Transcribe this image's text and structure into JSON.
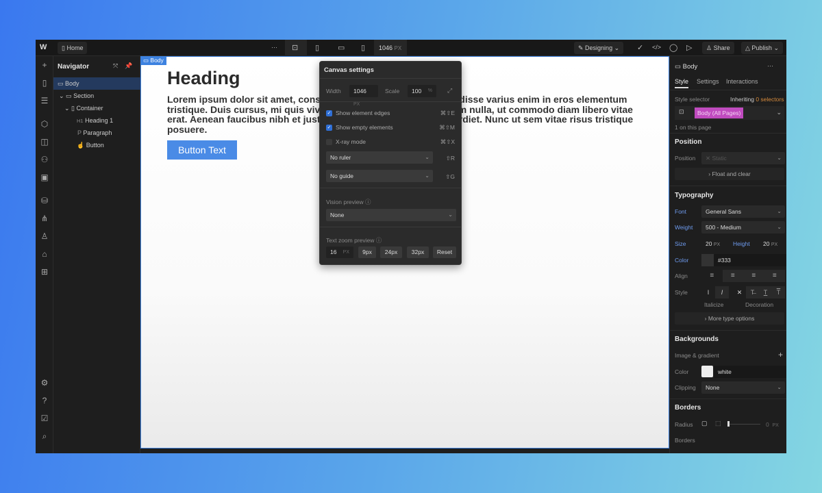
{
  "topbar": {
    "logo": "W",
    "page": "Home",
    "more": "···",
    "width_value": "1046",
    "width_unit": "PX",
    "mode": "Designing",
    "share": "Share",
    "publish": "Publish"
  },
  "navigator": {
    "title": "Navigator",
    "items": [
      {
        "label": "Body",
        "icon": "box-icon"
      },
      {
        "label": "Section",
        "icon": "box-icon"
      },
      {
        "label": "Container",
        "icon": "container-icon"
      },
      {
        "label": "Heading 1",
        "tag": "H1"
      },
      {
        "label": "Paragraph",
        "tag": "P"
      },
      {
        "label": "Button",
        "icon": "hand-icon"
      }
    ]
  },
  "canvas": {
    "body_badge": "Body",
    "heading": "Heading",
    "paragraph": "Lorem ipsum dolor sit amet, consectetur adipiscing elit. Suspendisse varius enim in eros elementum tristique. Duis cursus, mi quis viverra ornare, eros dolor interdum nulla, ut commodo diam libero vitae erat. Aenean faucibus nibh et justo cursus id rutrum lorem imperdiet. Nunc ut sem vitae risus tristique posuere.",
    "button": "Button Text",
    "button_color": "#4a8be6"
  },
  "canvas_settings": {
    "title": "Canvas settings",
    "width_label": "Width",
    "width_value": "1046",
    "width_unit": "PX",
    "scale_label": "Scale",
    "scale_value": "100",
    "scale_unit": "%",
    "options": [
      {
        "label": "Show element edges",
        "checked": true,
        "shortcut": "⌘⇧E"
      },
      {
        "label": "Show empty elements",
        "checked": true,
        "shortcut": "⌘⇧M"
      },
      {
        "label": "X-ray mode",
        "checked": false,
        "shortcut": "⌘⇧X"
      }
    ],
    "ruler": "No ruler",
    "ruler_shortcut": "⇧R",
    "guide": "No guide",
    "guide_shortcut": "⇧G",
    "vision_label": "Vision preview",
    "vision_value": "None",
    "text_zoom_label": "Text zoom preview",
    "text_zoom_value": "16",
    "text_zoom_unit": "PX",
    "presets": [
      "9px",
      "24px",
      "32px"
    ],
    "reset": "Reset"
  },
  "right_panel": {
    "element": "Body",
    "tabs": [
      "Style",
      "Settings",
      "Interactions"
    ],
    "style_selector": "Style selector",
    "inheriting": "Inheriting",
    "inherit_count": "0 selectors",
    "selector_chip": "Body (All Pages)",
    "selector_color": "#c04bbf",
    "on_page": "1 on this page",
    "position": {
      "title": "Position",
      "label": "Position",
      "value": "Static",
      "float": "Float and clear"
    },
    "typography": {
      "title": "Typography",
      "font_label": "Font",
      "font": "General Sans",
      "weight_label": "Weight",
      "weight": "500 - Medium",
      "size_label": "Size",
      "size": "20",
      "size_unit": "PX",
      "height_label": "Height",
      "height": "20",
      "height_unit": "PX",
      "color_label": "Color",
      "color": "#333",
      "align_label": "Align",
      "style_label": "Style",
      "italicize": "Italicize",
      "decoration": "Decoration",
      "more": "More type options"
    },
    "backgrounds": {
      "title": "Backgrounds",
      "image": "Image & gradient",
      "color_label": "Color",
      "color": "white",
      "clipping_label": "Clipping",
      "clipping": "None"
    },
    "borders": {
      "title": "Borders",
      "radius_label": "Radius",
      "radius": "0",
      "radius_unit": "PX",
      "borders_label": "Borders"
    }
  }
}
